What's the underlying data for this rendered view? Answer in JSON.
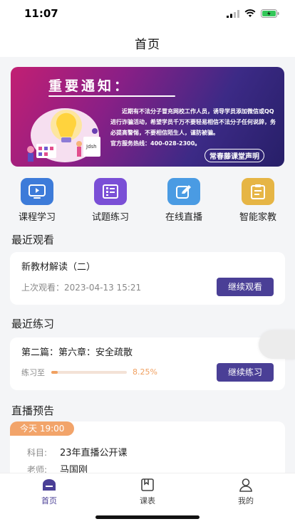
{
  "status_bar": {
    "time": "11:07"
  },
  "header": {
    "title": "首页"
  },
  "banner": {
    "title": "重要通知：",
    "body": "近期有不法分子冒充网校工作人员，诱导学员添加微信或QQ进行诈骗活动，希望学员千万不要轻易相信不法分子任何说辞，务必提高警惕，不要相信陌生人，谨防被骗。",
    "hotline": "官方服务热线：400-028-2300。",
    "signature": "常春藤课堂声明",
    "illustration_text": "Jdsh"
  },
  "quick_menu": [
    {
      "label": "课程学习",
      "icon": "video-play-icon",
      "color": "#3d7bd9"
    },
    {
      "label": "试题练习",
      "icon": "film-strip-icon",
      "color": "#7a4fd6"
    },
    {
      "label": "在线直播",
      "icon": "edit-pencil-icon",
      "color": "#4a9be3"
    },
    {
      "label": "智能家教",
      "icon": "clipboard-icon",
      "color": "#e6b545"
    }
  ],
  "recent_watch": {
    "section_title": "最近观看",
    "course": "新教材解读（二）",
    "last_watch": "上次观看：2023-04-13 15:21",
    "button": "继续观看"
  },
  "recent_practice": {
    "section_title": "最近练习",
    "title": "第二篇：第六章：安全疏散",
    "progress_label": "练习至",
    "progress_percent": "8.25%",
    "progress_value": 8.25,
    "button": "继续练习"
  },
  "live_preview": {
    "section_title": "直播预告",
    "tag": "今天 19:00",
    "subject_label": "科目:",
    "subject": "23年直播公开课",
    "teacher_label": "老师:",
    "teacher": "马国刚"
  },
  "tab_bar": [
    {
      "label": "首页",
      "icon": "home-icon",
      "active": true
    },
    {
      "label": "课表",
      "icon": "schedule-icon",
      "active": false
    },
    {
      "label": "我的",
      "icon": "user-icon",
      "active": false
    }
  ],
  "colors": {
    "accent": "#4a3f96",
    "orange": "#f0a060"
  }
}
